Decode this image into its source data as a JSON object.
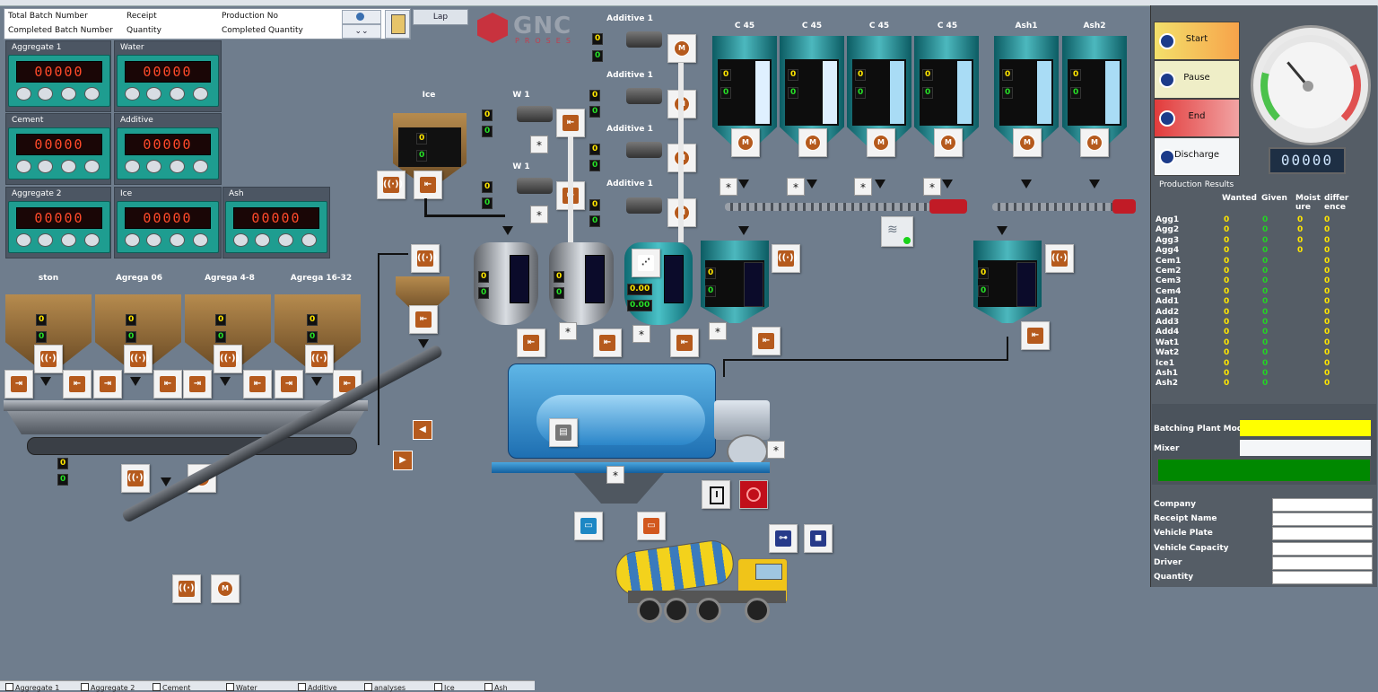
{
  "info": {
    "total_batch_label": "Total Batch Number",
    "completed_batch_label": "Completed Batch Number",
    "receipt_label": "Receipt",
    "quantity_label": "Quantity",
    "production_no_label": "Production No",
    "completed_quantity_label": "Completed Quantity",
    "lap_label": "Lap"
  },
  "logo": {
    "name": "GNC",
    "sub": "PROSES"
  },
  "scales": [
    {
      "title": "Aggregate 1",
      "value": "00000"
    },
    {
      "title": "Water",
      "value": "00000"
    },
    {
      "title": "Cement",
      "value": "00000"
    },
    {
      "title": "Additive",
      "value": "00000"
    },
    {
      "title": "Aggregate 2",
      "value": "00000"
    },
    {
      "title": "Ice",
      "value": "00000"
    },
    {
      "title": "Ash",
      "value": "00000"
    }
  ],
  "bins": [
    "ston",
    "Agrega 06",
    "Agrega 4-8",
    "Agrega 16-32"
  ],
  "labels": {
    "ice": "Ice",
    "w1a": "W 1",
    "w1b": "W 1",
    "additive": [
      "Additive 1",
      "Additive 1",
      "Additive 1",
      "Additive 1"
    ],
    "silos": [
      "C 45",
      "C 45",
      "C 45",
      "C 45",
      "Ash1",
      "Ash2"
    ]
  },
  "zero": "0",
  "zero_dec": "0.00",
  "star": "*",
  "controls": {
    "start": "Start",
    "pause": "Pause",
    "end": "End",
    "discharge": "Discharge",
    "counter": "00000"
  },
  "production": {
    "title": "Production Results",
    "headers": [
      "Wanted",
      "Given",
      "Moist ure",
      "differ ence"
    ],
    "rows": [
      "Agg1",
      "Agg2",
      "Agg3",
      "Agg4",
      "Cem1",
      "Cem2",
      "Cem3",
      "Cem4",
      "Add1",
      "Add2",
      "Add3",
      "Add4",
      "Wat1",
      "Wat2",
      "Ice1",
      "Ash1",
      "Ash2"
    ],
    "values": [
      [
        "0",
        "0",
        "0",
        "0"
      ],
      [
        "0",
        "0",
        "0",
        "0"
      ],
      [
        "0",
        "0",
        "0",
        "0"
      ],
      [
        "0",
        "0",
        "0",
        "0"
      ],
      [
        "0",
        "0",
        "",
        "0"
      ],
      [
        "0",
        "0",
        "",
        "0"
      ],
      [
        "0",
        "0",
        "",
        "0"
      ],
      [
        "0",
        "0",
        "",
        "0"
      ],
      [
        "0",
        "0",
        "",
        "0"
      ],
      [
        "0",
        "0",
        "",
        "0"
      ],
      [
        "0",
        "0",
        "",
        "0"
      ],
      [
        "0",
        "0",
        "",
        "0"
      ],
      [
        "0",
        "0",
        "",
        "0"
      ],
      [
        "0",
        "0",
        "",
        "0"
      ],
      [
        "0",
        "0",
        "",
        "0"
      ],
      [
        "0",
        "0",
        "",
        "0"
      ],
      [
        "0",
        "0",
        "",
        "0"
      ]
    ]
  },
  "mode": {
    "batching_label": "Batching Plant Mode",
    "mixer_label": "Mixer",
    "batching_color": "#ffff00",
    "status_color": "#008800"
  },
  "fields": [
    "Company",
    "Receipt Name",
    "Vehicle Plate",
    "Vehicle Capacity",
    "Driver",
    "Quantity"
  ],
  "bottom": [
    "Aggregate 1",
    "Aggregate 2",
    "Cement",
    "Water",
    "Additive",
    "analyses",
    "Ice",
    "Ash"
  ]
}
